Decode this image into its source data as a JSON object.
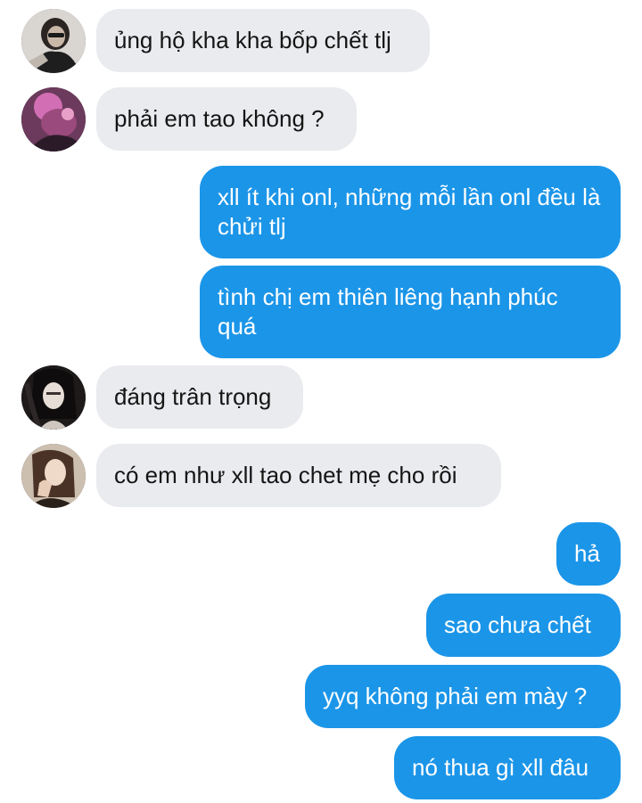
{
  "conversation": {
    "messages": [
      {
        "direction": "in",
        "text": "ủng hộ kha kha bốp chết tlj",
        "avatar": "avatar-1"
      },
      {
        "direction": "in",
        "text": "phải em tao không ?",
        "avatar": "avatar-2"
      },
      {
        "direction": "out",
        "text": "xll ít khi onl, những mỗi lần onl đều là chửi tlj"
      },
      {
        "direction": "out",
        "text": "tình chị em thiên liêng hạnh phúc quá"
      },
      {
        "direction": "in",
        "text": "đáng trân trọng",
        "avatar": "avatar-3"
      },
      {
        "direction": "in",
        "text": "có em như xll tao chet mẹ cho rồi",
        "avatar": "avatar-4"
      },
      {
        "direction": "out",
        "text": "hả"
      },
      {
        "direction": "out",
        "text": "sao chưa chết"
      },
      {
        "direction": "out",
        "text": "yyq không phải em mày ?"
      },
      {
        "direction": "out",
        "text": "nó thua gì xll đâu"
      }
    ]
  },
  "colors": {
    "incoming_bubble": "#e9ebee",
    "outgoing_bubble": "#1b95e8",
    "incoming_text": "#151515",
    "outgoing_text": "#ffffff",
    "background": "#ffffff"
  }
}
